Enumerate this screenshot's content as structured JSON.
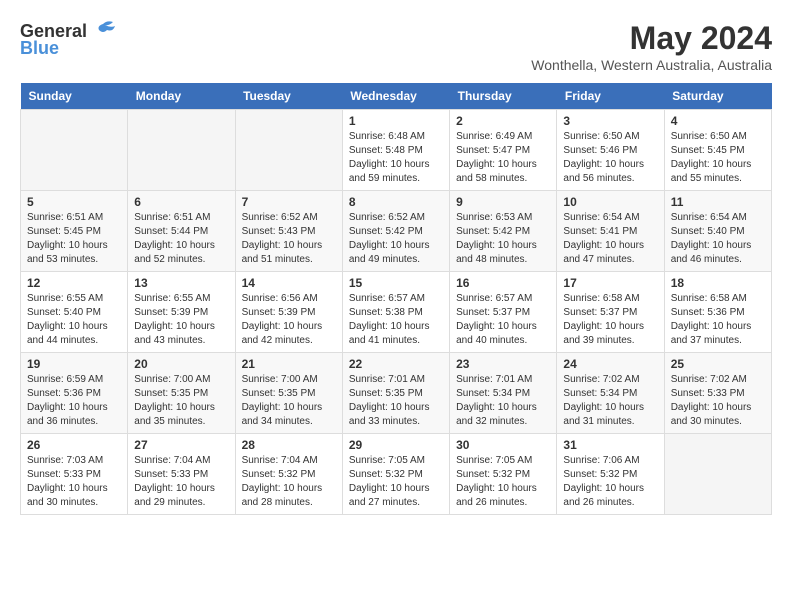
{
  "logo": {
    "general": "General",
    "blue": "Blue"
  },
  "title": {
    "month_year": "May 2024",
    "location": "Wonthella, Western Australia, Australia"
  },
  "headers": [
    "Sunday",
    "Monday",
    "Tuesday",
    "Wednesday",
    "Thursday",
    "Friday",
    "Saturday"
  ],
  "weeks": [
    [
      {
        "day": "",
        "sunrise": "",
        "sunset": "",
        "daylight": "",
        "empty": true
      },
      {
        "day": "",
        "sunrise": "",
        "sunset": "",
        "daylight": "",
        "empty": true
      },
      {
        "day": "",
        "sunrise": "",
        "sunset": "",
        "daylight": "",
        "empty": true
      },
      {
        "day": "1",
        "sunrise": "Sunrise: 6:48 AM",
        "sunset": "Sunset: 5:48 PM",
        "daylight": "Daylight: 10 hours and 59 minutes.",
        "empty": false
      },
      {
        "day": "2",
        "sunrise": "Sunrise: 6:49 AM",
        "sunset": "Sunset: 5:47 PM",
        "daylight": "Daylight: 10 hours and 58 minutes.",
        "empty": false
      },
      {
        "day": "3",
        "sunrise": "Sunrise: 6:50 AM",
        "sunset": "Sunset: 5:46 PM",
        "daylight": "Daylight: 10 hours and 56 minutes.",
        "empty": false
      },
      {
        "day": "4",
        "sunrise": "Sunrise: 6:50 AM",
        "sunset": "Sunset: 5:45 PM",
        "daylight": "Daylight: 10 hours and 55 minutes.",
        "empty": false
      }
    ],
    [
      {
        "day": "5",
        "sunrise": "Sunrise: 6:51 AM",
        "sunset": "Sunset: 5:45 PM",
        "daylight": "Daylight: 10 hours and 53 minutes.",
        "empty": false
      },
      {
        "day": "6",
        "sunrise": "Sunrise: 6:51 AM",
        "sunset": "Sunset: 5:44 PM",
        "daylight": "Daylight: 10 hours and 52 minutes.",
        "empty": false
      },
      {
        "day": "7",
        "sunrise": "Sunrise: 6:52 AM",
        "sunset": "Sunset: 5:43 PM",
        "daylight": "Daylight: 10 hours and 51 minutes.",
        "empty": false
      },
      {
        "day": "8",
        "sunrise": "Sunrise: 6:52 AM",
        "sunset": "Sunset: 5:42 PM",
        "daylight": "Daylight: 10 hours and 49 minutes.",
        "empty": false
      },
      {
        "day": "9",
        "sunrise": "Sunrise: 6:53 AM",
        "sunset": "Sunset: 5:42 PM",
        "daylight": "Daylight: 10 hours and 48 minutes.",
        "empty": false
      },
      {
        "day": "10",
        "sunrise": "Sunrise: 6:54 AM",
        "sunset": "Sunset: 5:41 PM",
        "daylight": "Daylight: 10 hours and 47 minutes.",
        "empty": false
      },
      {
        "day": "11",
        "sunrise": "Sunrise: 6:54 AM",
        "sunset": "Sunset: 5:40 PM",
        "daylight": "Daylight: 10 hours and 46 minutes.",
        "empty": false
      }
    ],
    [
      {
        "day": "12",
        "sunrise": "Sunrise: 6:55 AM",
        "sunset": "Sunset: 5:40 PM",
        "daylight": "Daylight: 10 hours and 44 minutes.",
        "empty": false
      },
      {
        "day": "13",
        "sunrise": "Sunrise: 6:55 AM",
        "sunset": "Sunset: 5:39 PM",
        "daylight": "Daylight: 10 hours and 43 minutes.",
        "empty": false
      },
      {
        "day": "14",
        "sunrise": "Sunrise: 6:56 AM",
        "sunset": "Sunset: 5:39 PM",
        "daylight": "Daylight: 10 hours and 42 minutes.",
        "empty": false
      },
      {
        "day": "15",
        "sunrise": "Sunrise: 6:57 AM",
        "sunset": "Sunset: 5:38 PM",
        "daylight": "Daylight: 10 hours and 41 minutes.",
        "empty": false
      },
      {
        "day": "16",
        "sunrise": "Sunrise: 6:57 AM",
        "sunset": "Sunset: 5:37 PM",
        "daylight": "Daylight: 10 hours and 40 minutes.",
        "empty": false
      },
      {
        "day": "17",
        "sunrise": "Sunrise: 6:58 AM",
        "sunset": "Sunset: 5:37 PM",
        "daylight": "Daylight: 10 hours and 39 minutes.",
        "empty": false
      },
      {
        "day": "18",
        "sunrise": "Sunrise: 6:58 AM",
        "sunset": "Sunset: 5:36 PM",
        "daylight": "Daylight: 10 hours and 37 minutes.",
        "empty": false
      }
    ],
    [
      {
        "day": "19",
        "sunrise": "Sunrise: 6:59 AM",
        "sunset": "Sunset: 5:36 PM",
        "daylight": "Daylight: 10 hours and 36 minutes.",
        "empty": false
      },
      {
        "day": "20",
        "sunrise": "Sunrise: 7:00 AM",
        "sunset": "Sunset: 5:35 PM",
        "daylight": "Daylight: 10 hours and 35 minutes.",
        "empty": false
      },
      {
        "day": "21",
        "sunrise": "Sunrise: 7:00 AM",
        "sunset": "Sunset: 5:35 PM",
        "daylight": "Daylight: 10 hours and 34 minutes.",
        "empty": false
      },
      {
        "day": "22",
        "sunrise": "Sunrise: 7:01 AM",
        "sunset": "Sunset: 5:35 PM",
        "daylight": "Daylight: 10 hours and 33 minutes.",
        "empty": false
      },
      {
        "day": "23",
        "sunrise": "Sunrise: 7:01 AM",
        "sunset": "Sunset: 5:34 PM",
        "daylight": "Daylight: 10 hours and 32 minutes.",
        "empty": false
      },
      {
        "day": "24",
        "sunrise": "Sunrise: 7:02 AM",
        "sunset": "Sunset: 5:34 PM",
        "daylight": "Daylight: 10 hours and 31 minutes.",
        "empty": false
      },
      {
        "day": "25",
        "sunrise": "Sunrise: 7:02 AM",
        "sunset": "Sunset: 5:33 PM",
        "daylight": "Daylight: 10 hours and 30 minutes.",
        "empty": false
      }
    ],
    [
      {
        "day": "26",
        "sunrise": "Sunrise: 7:03 AM",
        "sunset": "Sunset: 5:33 PM",
        "daylight": "Daylight: 10 hours and 30 minutes.",
        "empty": false
      },
      {
        "day": "27",
        "sunrise": "Sunrise: 7:04 AM",
        "sunset": "Sunset: 5:33 PM",
        "daylight": "Daylight: 10 hours and 29 minutes.",
        "empty": false
      },
      {
        "day": "28",
        "sunrise": "Sunrise: 7:04 AM",
        "sunset": "Sunset: 5:32 PM",
        "daylight": "Daylight: 10 hours and 28 minutes.",
        "empty": false
      },
      {
        "day": "29",
        "sunrise": "Sunrise: 7:05 AM",
        "sunset": "Sunset: 5:32 PM",
        "daylight": "Daylight: 10 hours and 27 minutes.",
        "empty": false
      },
      {
        "day": "30",
        "sunrise": "Sunrise: 7:05 AM",
        "sunset": "Sunset: 5:32 PM",
        "daylight": "Daylight: 10 hours and 26 minutes.",
        "empty": false
      },
      {
        "day": "31",
        "sunrise": "Sunrise: 7:06 AM",
        "sunset": "Sunset: 5:32 PM",
        "daylight": "Daylight: 10 hours and 26 minutes.",
        "empty": false
      },
      {
        "day": "",
        "sunrise": "",
        "sunset": "",
        "daylight": "",
        "empty": true
      }
    ]
  ]
}
